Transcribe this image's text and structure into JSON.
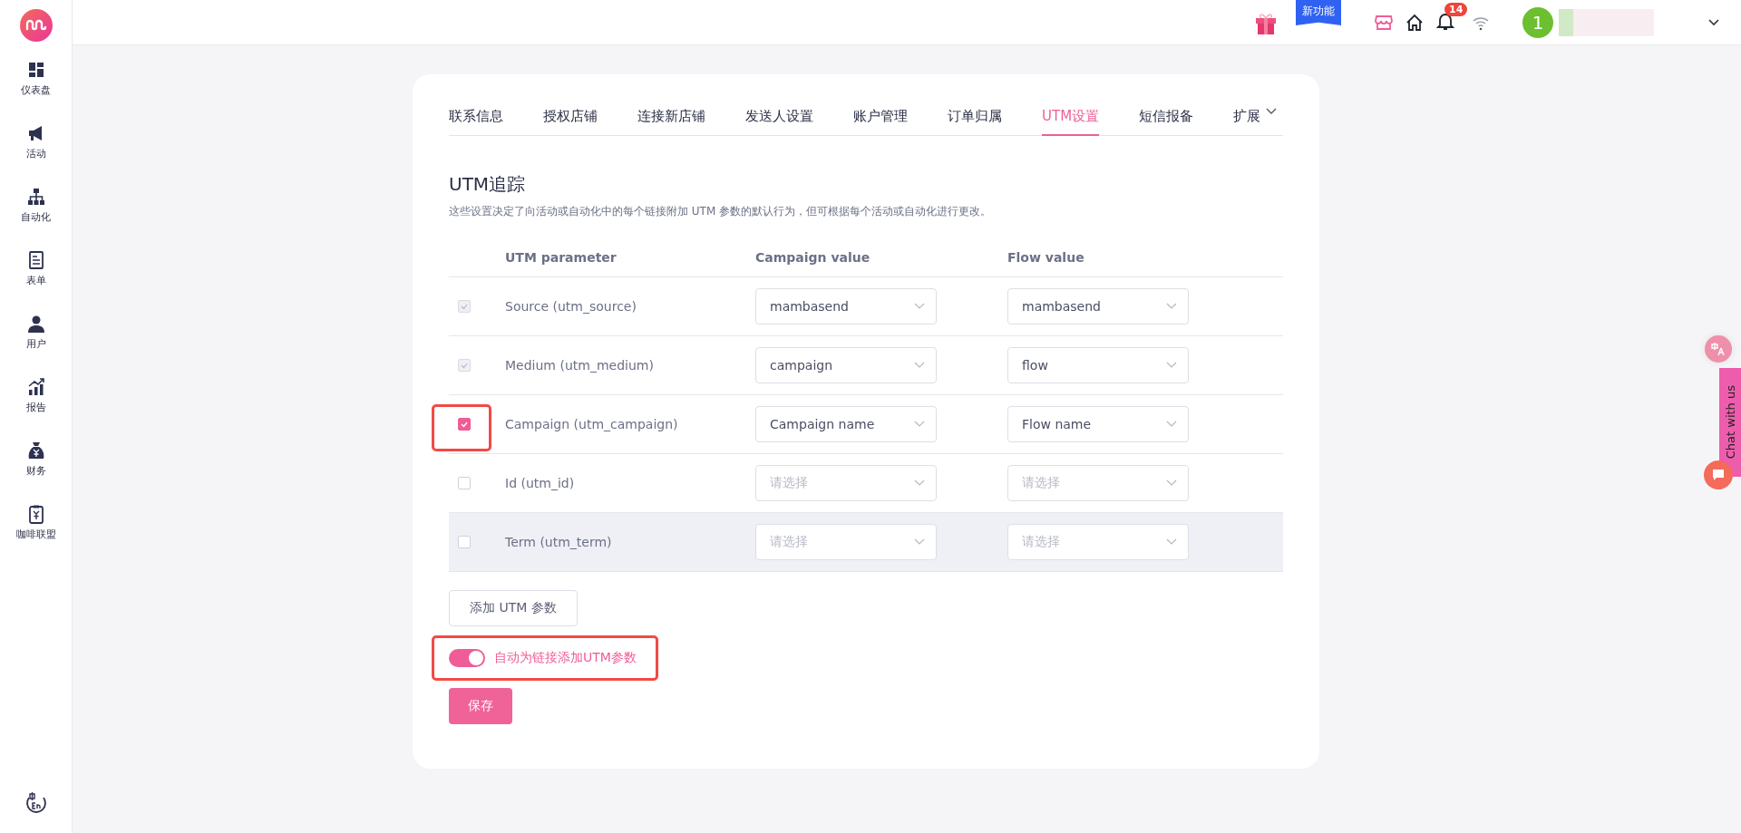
{
  "sidebar": {
    "items": [
      {
        "label": "仪表盘"
      },
      {
        "label": "活动"
      },
      {
        "label": "自动化"
      },
      {
        "label": "表单"
      },
      {
        "label": "用户"
      },
      {
        "label": "报告"
      },
      {
        "label": "财务"
      },
      {
        "label": "咖啡联盟"
      }
    ]
  },
  "top_bar": {
    "new_feature": "新功能",
    "notification_count": "14",
    "avatar": "1"
  },
  "tabs": [
    {
      "label": "联系信息",
      "selected": false
    },
    {
      "label": "授权店铺",
      "selected": false
    },
    {
      "label": "连接新店铺",
      "selected": false
    },
    {
      "label": "发送人设置",
      "selected": false
    },
    {
      "label": "账户管理",
      "selected": false
    },
    {
      "label": "订单归属",
      "selected": false
    },
    {
      "label": "UTM设置",
      "selected": true
    },
    {
      "label": "短信报备",
      "selected": false
    },
    {
      "label": "扩展",
      "selected": false,
      "kind": "dropdown"
    }
  ],
  "section": {
    "title": "UTM追踪",
    "description": "这些设置决定了向活动或自动化中的每个链接附加 UTM 参数的默认行为，但可根据每个活动或自动化进行更改。"
  },
  "table": {
    "columns": [
      "UTM parameter",
      "Campaign value",
      "Flow value"
    ],
    "rows": [
      {
        "checked": true,
        "disabled": true,
        "highlighted": false,
        "hovered": false,
        "parameter": "Source (utm_source)",
        "campaign": {
          "value": "mambasend"
        },
        "flow": {
          "value": "mambasend"
        }
      },
      {
        "checked": true,
        "disabled": true,
        "highlighted": false,
        "hovered": false,
        "parameter": "Medium (utm_medium)",
        "campaign": {
          "value": "campaign"
        },
        "flow": {
          "value": "flow"
        }
      },
      {
        "checked": true,
        "disabled": false,
        "highlighted": true,
        "hovered": false,
        "parameter": "Campaign (utm_campaign)",
        "campaign": {
          "value": "Campaign name"
        },
        "flow": {
          "value": "Flow name"
        }
      },
      {
        "checked": false,
        "disabled": false,
        "highlighted": false,
        "hovered": false,
        "parameter": "Id (utm_id)",
        "campaign": {
          "placeholder": "请选择"
        },
        "flow": {
          "placeholder": "请选择"
        }
      },
      {
        "checked": false,
        "disabled": false,
        "highlighted": false,
        "hovered": true,
        "parameter": "Term (utm_term)",
        "campaign": {
          "placeholder": "请选择"
        },
        "flow": {
          "placeholder": "请选择"
        }
      }
    ]
  },
  "add_button": "添加 UTM 参数",
  "auto_toggle": {
    "label": "自动为链接添加UTM参数",
    "on": true,
    "highlighted": true
  },
  "save_button": "保存",
  "chat_widget": {
    "label": "Chat with us"
  }
}
